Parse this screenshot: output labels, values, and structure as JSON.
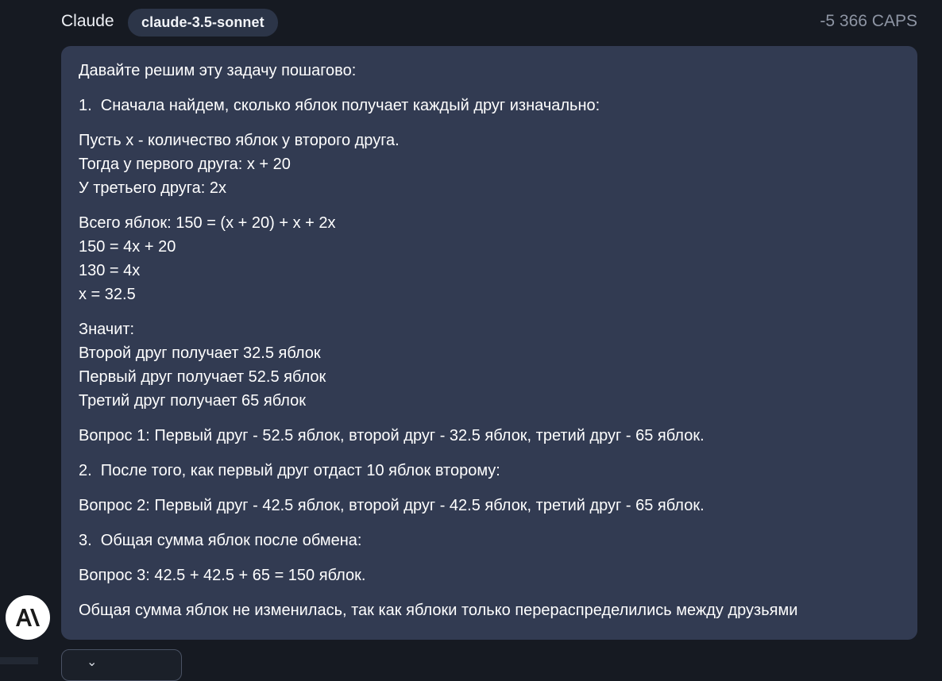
{
  "message": {
    "sender": "Claude",
    "model": "claude-3.5-sonnet",
    "cost": "-5 366 CAPS",
    "paragraphs": [
      [
        "Давайте решим эту задачу пошагово:"
      ],
      [
        "1.  Сначала найдем, сколько яблок получает каждый друг изначально:"
      ],
      [
        "Пусть x - количество яблок у второго друга.",
        "Тогда у первого друга: x + 20",
        "У третьего друга: 2x"
      ],
      [
        "Всего яблок: 150 = (x + 20) + x + 2x",
        "150 = 4x + 20",
        "130 = 4x",
        "x = 32.5"
      ],
      [
        "Значит:",
        "Второй друг получает 32.5 яблок",
        "Первый друг получает 52.5 яблок",
        "Третий друг получает 65 яблок"
      ],
      [
        "Вопрос 1: Первый друг - 52.5 яблок, второй друг - 32.5 яблок, третий друг - 65 яблок."
      ],
      [
        "2.  После того, как первый друг отдаст 10 яблок второму:"
      ],
      [
        "Вопрос 2: Первый друг - 42.5 яблок, второй друг - 42.5 яблок, третий друг - 65 яблок."
      ],
      [
        "3.  Общая сумма яблок после обмена:"
      ],
      [
        "Вопрос 3: 42.5 + 42.5 + 65 = 150 яблок."
      ],
      [
        "Общая сумма яблок не изменилась, так как яблоки только перераспределились между друзьями"
      ]
    ]
  },
  "avatar": {
    "icon": "anthropic-logo-icon",
    "background": "#ffffff",
    "foreground": "#1a1a1a"
  },
  "colors": {
    "page_background": "#161a22",
    "bubble_background": "#323b52",
    "badge_background": "#2c3548",
    "cost_text": "#8e95a4"
  }
}
